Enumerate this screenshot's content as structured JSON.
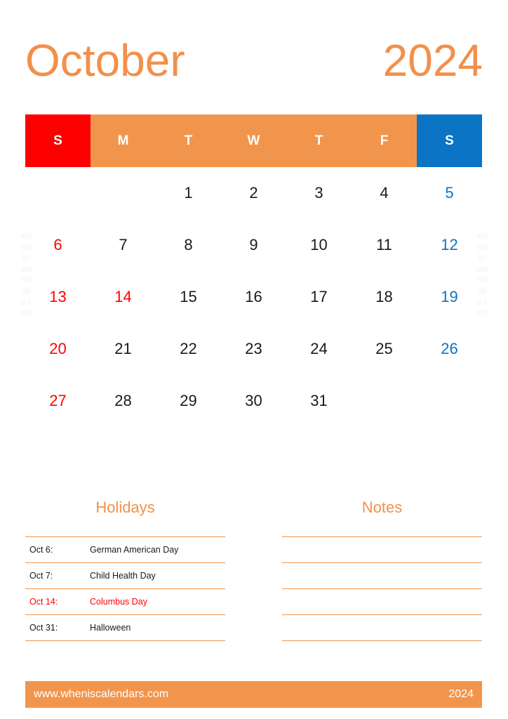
{
  "title": {
    "month": "October",
    "year": "2024"
  },
  "colors": {
    "orange": "#F2954C",
    "title_orange": "#F2904B",
    "sunday_red": "#FF0000",
    "saturday_blue": "#0B74C4",
    "text_dark": "#1a1a1a",
    "watermark_gray": "#F2F2F2"
  },
  "watermark": {
    "text": "wheniscalendars.com"
  },
  "weekdays": [
    {
      "label": "S",
      "kind": "sun"
    },
    {
      "label": "M",
      "kind": "mid"
    },
    {
      "label": "T",
      "kind": "mid"
    },
    {
      "label": "W",
      "kind": "mid"
    },
    {
      "label": "T",
      "kind": "mid"
    },
    {
      "label": "F",
      "kind": "mid"
    },
    {
      "label": "S",
      "kind": "sat"
    }
  ],
  "days": [
    {
      "n": "",
      "kind": "empty"
    },
    {
      "n": "",
      "kind": "empty"
    },
    {
      "n": "1",
      "kind": "weekday"
    },
    {
      "n": "2",
      "kind": "weekday"
    },
    {
      "n": "3",
      "kind": "weekday"
    },
    {
      "n": "4",
      "kind": "weekday"
    },
    {
      "n": "5",
      "kind": "sat"
    },
    {
      "n": "6",
      "kind": "sun"
    },
    {
      "n": "7",
      "kind": "weekday"
    },
    {
      "n": "8",
      "kind": "weekday"
    },
    {
      "n": "9",
      "kind": "weekday"
    },
    {
      "n": "10",
      "kind": "weekday"
    },
    {
      "n": "11",
      "kind": "weekday"
    },
    {
      "n": "12",
      "kind": "sat"
    },
    {
      "n": "13",
      "kind": "sun"
    },
    {
      "n": "14",
      "kind": "holiday"
    },
    {
      "n": "15",
      "kind": "weekday"
    },
    {
      "n": "16",
      "kind": "weekday"
    },
    {
      "n": "17",
      "kind": "weekday"
    },
    {
      "n": "18",
      "kind": "weekday"
    },
    {
      "n": "19",
      "kind": "sat"
    },
    {
      "n": "20",
      "kind": "sun"
    },
    {
      "n": "21",
      "kind": "weekday"
    },
    {
      "n": "22",
      "kind": "weekday"
    },
    {
      "n": "23",
      "kind": "weekday"
    },
    {
      "n": "24",
      "kind": "weekday"
    },
    {
      "n": "25",
      "kind": "weekday"
    },
    {
      "n": "26",
      "kind": "sat"
    },
    {
      "n": "27",
      "kind": "sun"
    },
    {
      "n": "28",
      "kind": "weekday"
    },
    {
      "n": "29",
      "kind": "weekday"
    },
    {
      "n": "30",
      "kind": "weekday"
    },
    {
      "n": "31",
      "kind": "weekday"
    },
    {
      "n": "",
      "kind": "empty"
    },
    {
      "n": "",
      "kind": "empty"
    }
  ],
  "holidays": {
    "title": "Holidays",
    "rows": [
      {
        "date": "Oct 6:",
        "name": "German American Day",
        "highlight": false
      },
      {
        "date": "Oct 7:",
        "name": "Child Health Day",
        "highlight": false
      },
      {
        "date": "Oct 14:",
        "name": "Columbus Day",
        "highlight": true
      },
      {
        "date": "Oct 31:",
        "name": "Halloween",
        "highlight": false
      }
    ]
  },
  "notes": {
    "title": "Notes",
    "line_count": 5
  },
  "footer": {
    "url": "www.wheniscalendars.com",
    "year": "2024"
  }
}
